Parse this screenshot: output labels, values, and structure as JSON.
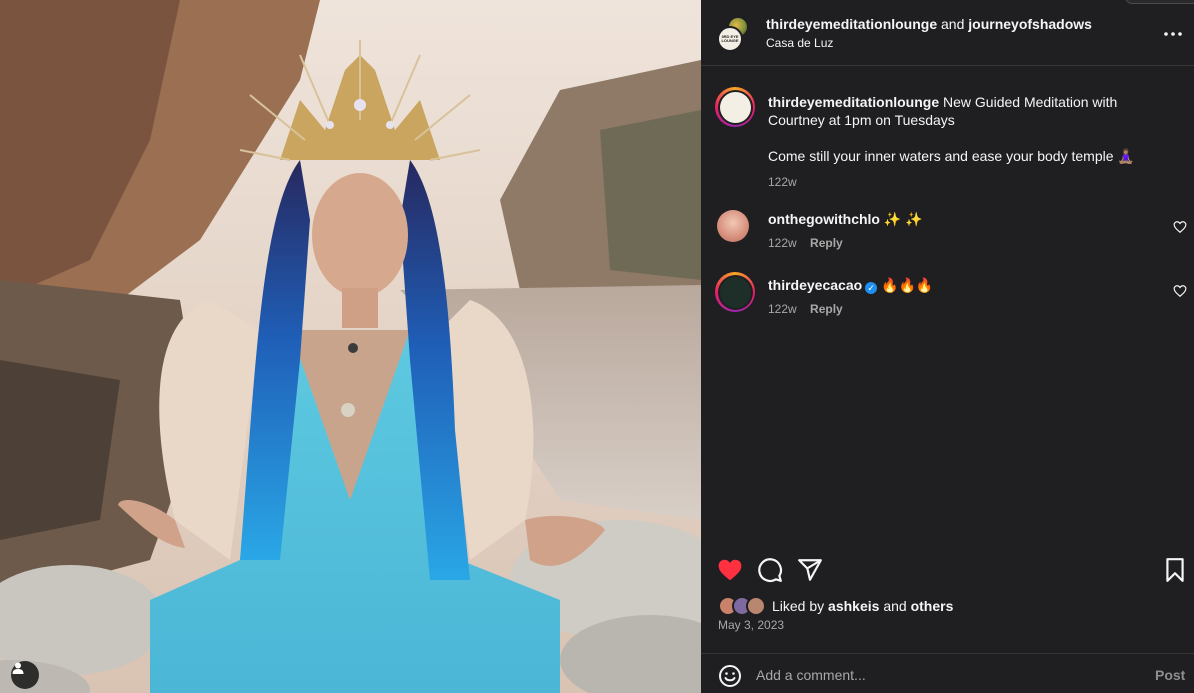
{
  "header": {
    "author_primary": "thirdeyemeditationlounge",
    "joiner": "and",
    "author_secondary": "journeyofshadows",
    "location": "Casa de Luz",
    "avatar_lettering": "3RD EYE LOUNGE"
  },
  "caption": {
    "username": "thirdeyemeditationlounge",
    "text_line1": "New Guided Meditation with Courtney at 1pm on Tuesdays",
    "text_line2": "Come still your inner waters and ease your body temple 🧘🏽‍♀️",
    "time": "122w"
  },
  "comments": [
    {
      "username": "onthegowithchlo",
      "text": "✨ ✨",
      "time": "122w",
      "reply_label": "Reply",
      "verified": false
    },
    {
      "username": "thirdeyecacao",
      "text": "🔥🔥🔥",
      "time": "122w",
      "reply_label": "Reply",
      "verified": true
    }
  ],
  "likes": {
    "prefix": "Liked by",
    "first_user": "ashkeis",
    "joiner": "and",
    "others_label": "others"
  },
  "post_date": "May 3, 2023",
  "comment_box": {
    "placeholder": "Add a comment...",
    "post_label": "Post"
  },
  "icons": {
    "like": "heart-icon",
    "comment": "comment-icon",
    "share": "share-icon",
    "save": "bookmark-icon",
    "more": "more-icon",
    "emoji": "emoji-icon",
    "tag": "user-tag-icon"
  },
  "colors": {
    "panel_bg": "#1f1f22",
    "like_red": "#ff3040",
    "secondary_text": "#a8a8a8",
    "verified_blue": "#1f8ef1"
  }
}
